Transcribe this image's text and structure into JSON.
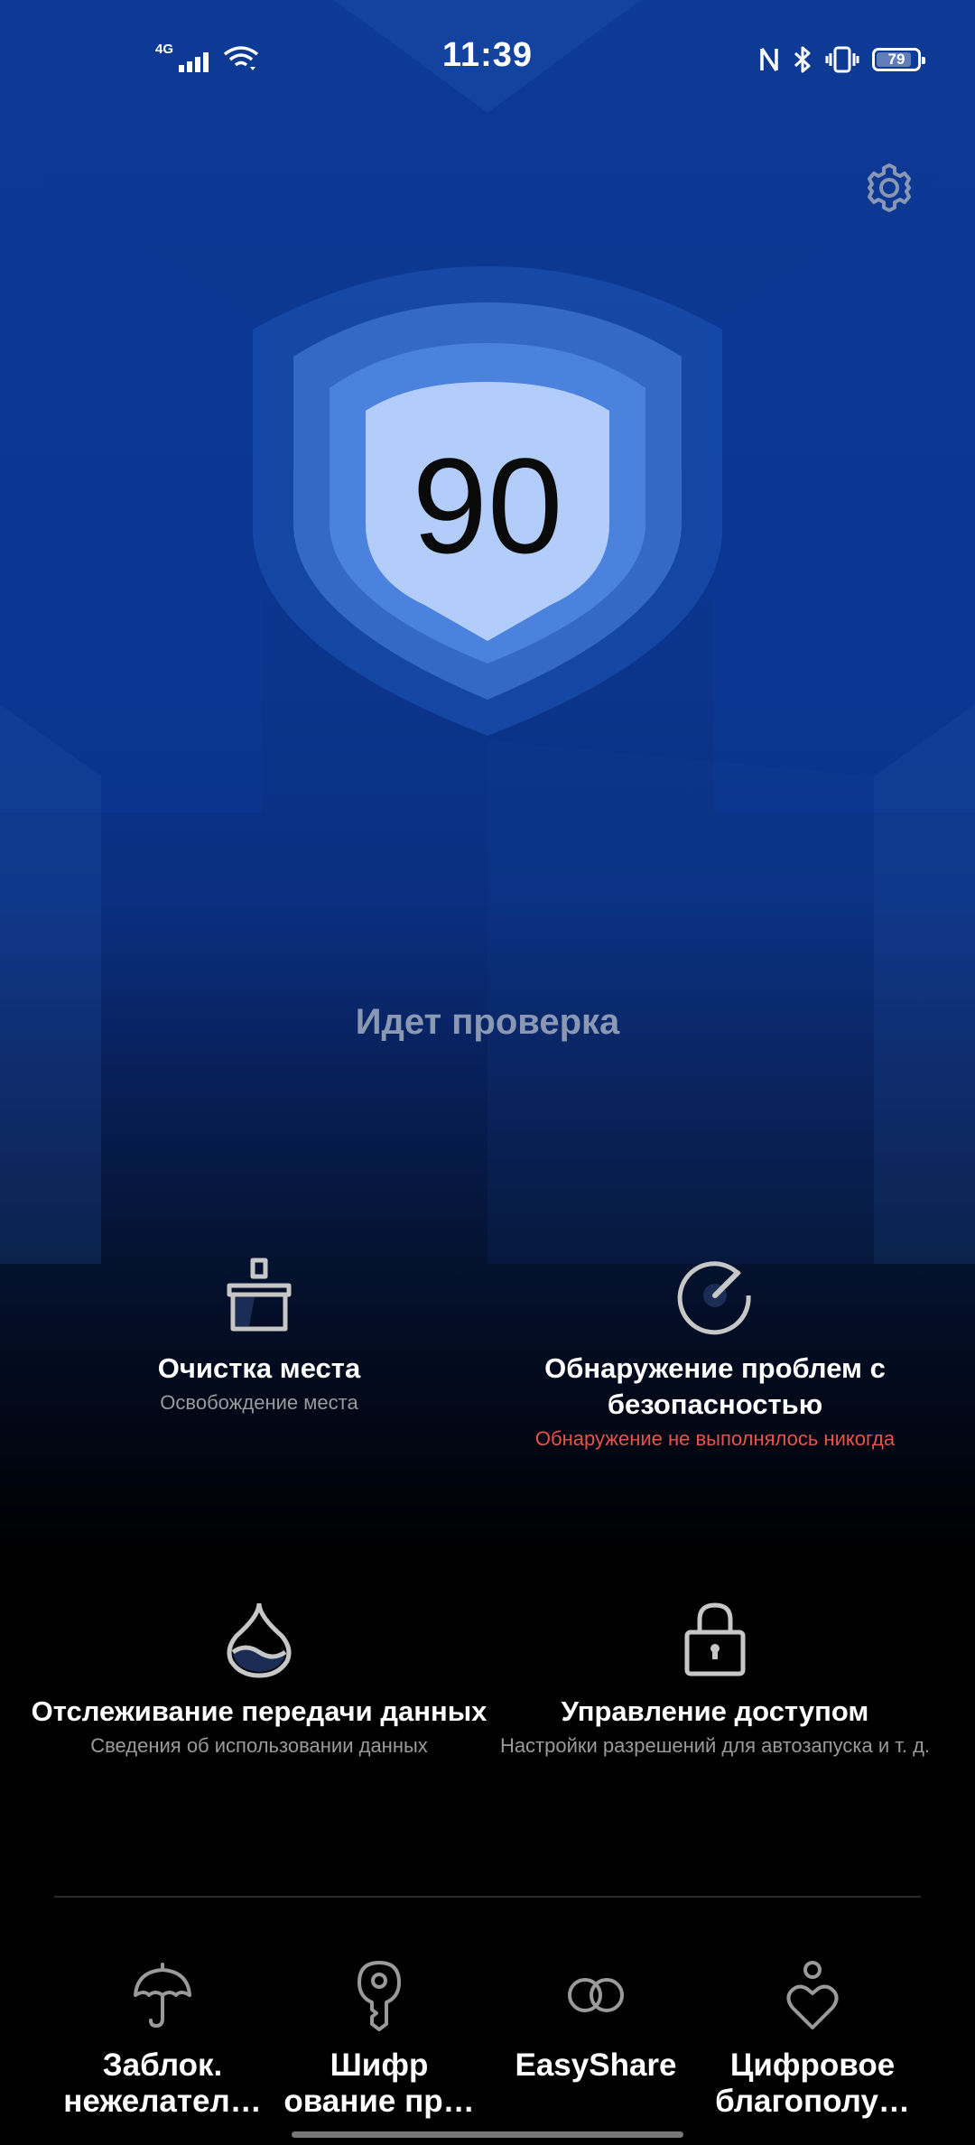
{
  "status_bar": {
    "time": "11:39",
    "network_label": "4G",
    "battery_level": "79",
    "battery_percent": 79,
    "icons": [
      "signal-icon",
      "wifi-icon",
      "nfc-icon",
      "bluetooth-icon",
      "vibrate-icon",
      "battery-icon"
    ]
  },
  "header": {
    "settings_icon": "gear-icon"
  },
  "score": {
    "value": "90",
    "status": "Идет проверка"
  },
  "features": [
    {
      "title": "Очистка места",
      "subtitle": "Освобождение места",
      "icon": "broom-icon",
      "subtitle_color": "#9a9a9a"
    },
    {
      "title": "Обнаружение проблем с безопасностью",
      "subtitle": "Обнаружение не выполнялось никогда",
      "icon": "gauge-icon",
      "subtitle_color": "#e9524a"
    },
    {
      "title": "Отслеживание передачи данных",
      "subtitle": "Сведения об использовании данных",
      "icon": "drop-icon",
      "subtitle_color": "#9a9a9a"
    },
    {
      "title": "Управление доступом",
      "subtitle": "Настройки разрешений для автозапуска и т. д.",
      "icon": "lock-icon",
      "subtitle_color": "#9a9a9a"
    }
  ],
  "tools": [
    {
      "label": "Заблок. нежелател…",
      "icon": "umbrella-icon"
    },
    {
      "label": "Шифр ование пр…",
      "icon": "key-icon"
    },
    {
      "label": "EasyShare",
      "icon": "link-rings-icon"
    },
    {
      "label": "Цифровое благополу…",
      "icon": "heart-person-icon"
    }
  ],
  "colors": {
    "background_top": "#0d3a96",
    "background_bottom": "#000000",
    "shield_inner": "#b3cdfa",
    "shield_mid": "#3f74d2",
    "warning_text": "#e9524a"
  }
}
